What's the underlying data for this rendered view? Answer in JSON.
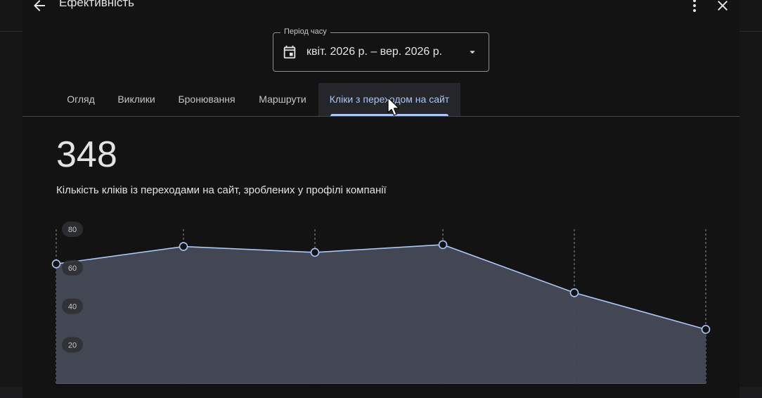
{
  "header": {
    "title": "Ефективність",
    "icons": {
      "back": "arrow-back-icon",
      "more": "more-vert-icon",
      "close": "close-icon"
    }
  },
  "date_range": {
    "label": "Період часу",
    "value": "квіт. 2026 р. – вер. 2026 р.",
    "icon": "calendar-icon",
    "dropdown_icon": "arrow-drop-down-icon"
  },
  "tabs": [
    {
      "label": "Огляд",
      "active": false
    },
    {
      "label": "Виклики",
      "active": false
    },
    {
      "label": "Бронювання",
      "active": false
    },
    {
      "label": "Маршрути",
      "active": false
    },
    {
      "label": "Кліки з переходом на сайт",
      "active": true
    }
  ],
  "metric": {
    "value": "348",
    "description": "Кількість кліків із переходами на сайт, зроблених у профілі компанії"
  },
  "colors": {
    "accent": "#a8c7fa",
    "line": "#a8c7fa",
    "area_fill": "#464a56",
    "background": "#131314"
  },
  "chart_data": {
    "type": "area",
    "y_ticks": [
      "80",
      "60",
      "40",
      "20"
    ],
    "ylim": [
      0,
      80
    ],
    "x_points": 6,
    "values": [
      62,
      71,
      68,
      72,
      47,
      28
    ],
    "grid": "vertical-dashed",
    "xlabel": "",
    "ylabel": ""
  }
}
